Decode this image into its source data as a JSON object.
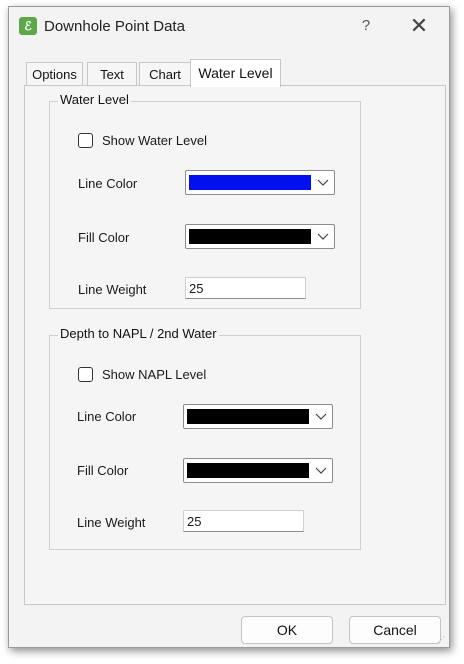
{
  "window": {
    "title": "Downhole Point Data",
    "help_label": "?",
    "close_label": "✕"
  },
  "tabs": [
    {
      "label": "Options",
      "active": false
    },
    {
      "label": "Text",
      "active": false
    },
    {
      "label": "Chart",
      "active": false
    },
    {
      "label": "Water Level",
      "active": true
    }
  ],
  "water_level": {
    "group_title": "Water Level",
    "show_label": "Show Water Level",
    "show_checked": false,
    "line_color_label": "Line Color",
    "line_color": "#0010ee",
    "fill_color_label": "Fill Color",
    "fill_color": "#000000",
    "line_weight_label": "Line Weight",
    "line_weight": "25"
  },
  "napl": {
    "group_title": "Depth to NAPL / 2nd Water",
    "show_label": "Show NAPL Level",
    "show_checked": false,
    "line_color_label": "Line Color",
    "line_color": "#000000",
    "fill_color_label": "Fill Color",
    "fill_color": "#000000",
    "line_weight_label": "Line Weight",
    "line_weight": "25"
  },
  "buttons": {
    "ok": "OK",
    "cancel": "Cancel"
  }
}
